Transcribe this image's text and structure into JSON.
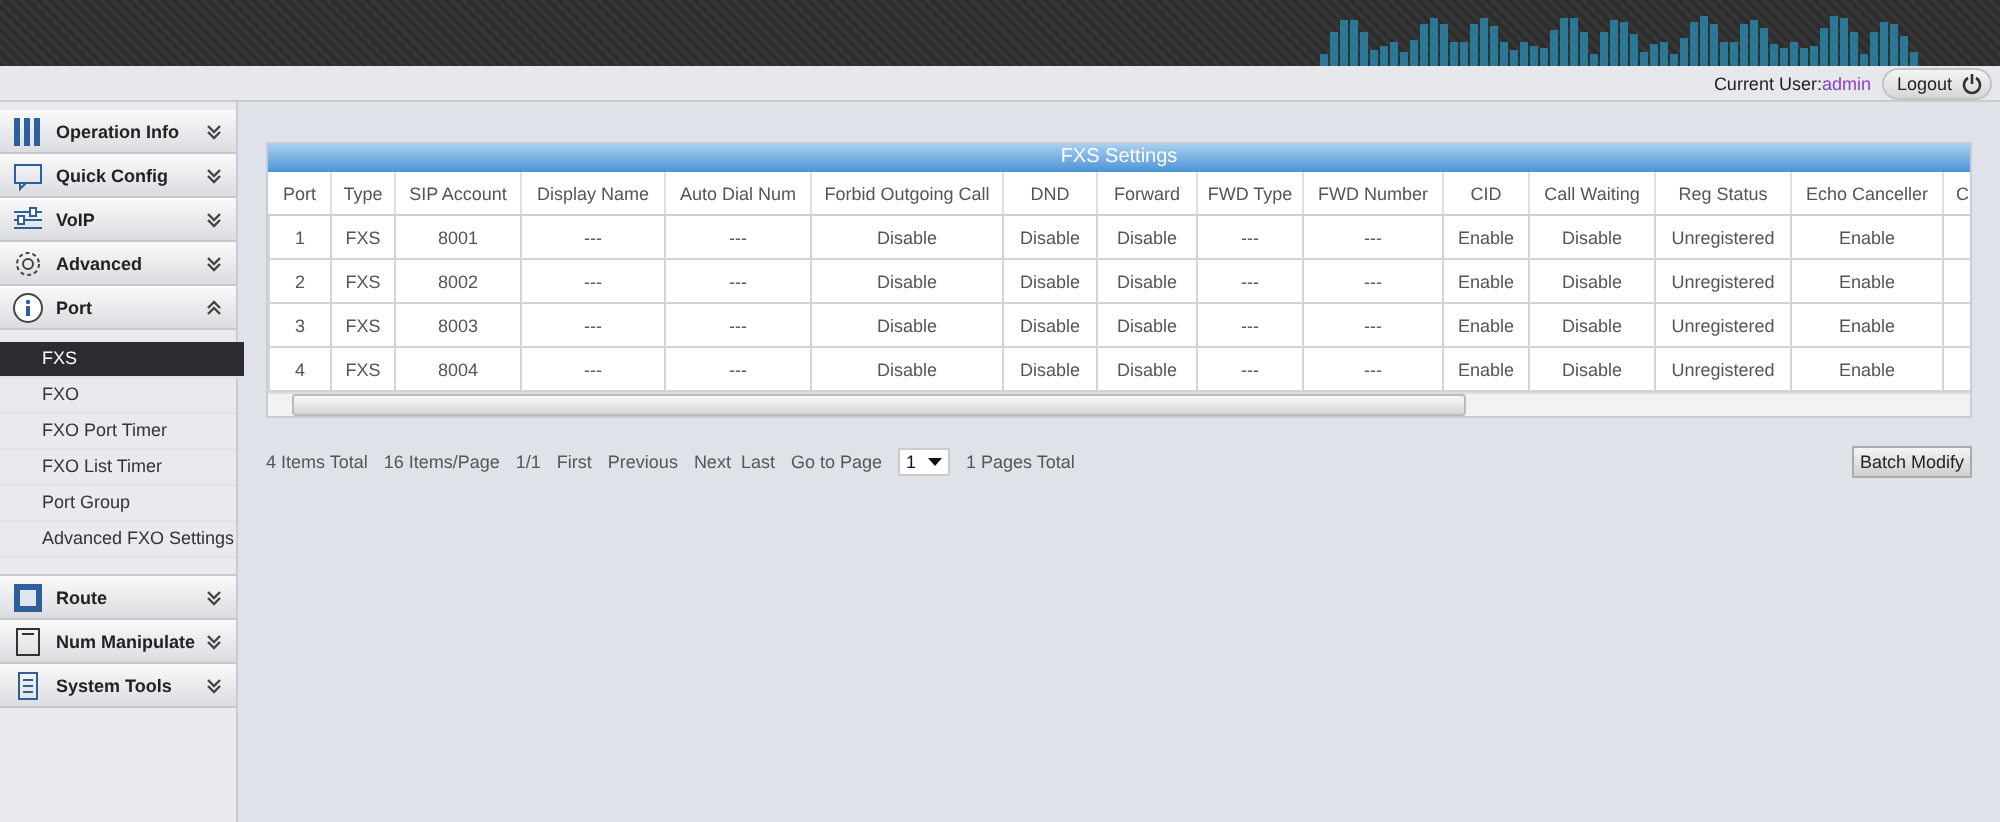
{
  "header": {
    "user_label": "Current User:",
    "user_name": "admin",
    "logout": "Logout"
  },
  "sidebar": {
    "items": [
      {
        "label": "Operation Info",
        "expanded": false
      },
      {
        "label": "Quick Config",
        "expanded": false
      },
      {
        "label": "VoIP",
        "expanded": false
      },
      {
        "label": "Advanced",
        "expanded": false
      },
      {
        "label": "Port",
        "expanded": true,
        "children": [
          {
            "label": "FXS",
            "selected": true
          },
          {
            "label": "FXO",
            "selected": false
          },
          {
            "label": "FXO Port Timer",
            "selected": false
          },
          {
            "label": "FXO List Timer",
            "selected": false
          },
          {
            "label": "Port Group",
            "selected": false
          },
          {
            "label": "Advanced FXO Settings",
            "selected": false
          }
        ]
      },
      {
        "label": "Route",
        "expanded": false
      },
      {
        "label": "Num Manipulate",
        "expanded": false
      },
      {
        "label": "System Tools",
        "expanded": false
      }
    ]
  },
  "table": {
    "title": "FXS Settings",
    "columns": [
      "Port",
      "Type",
      "SIP Account",
      "Display Name",
      "Auto Dial Num",
      "Forbid Outgoing Call",
      "DND",
      "Forward",
      "FWD Type",
      "FWD Number",
      "CID",
      "Call Waiting",
      "Reg Status",
      "Echo Canceller",
      "C"
    ],
    "rows": [
      [
        "1",
        "FXS",
        "8001",
        "---",
        "---",
        "Disable",
        "Disable",
        "Disable",
        "---",
        "---",
        "Enable",
        "Disable",
        "Unregistered",
        "Enable"
      ],
      [
        "2",
        "FXS",
        "8002",
        "---",
        "---",
        "Disable",
        "Disable",
        "Disable",
        "---",
        "---",
        "Enable",
        "Disable",
        "Unregistered",
        "Enable"
      ],
      [
        "3",
        "FXS",
        "8003",
        "---",
        "---",
        "Disable",
        "Disable",
        "Disable",
        "---",
        "---",
        "Enable",
        "Disable",
        "Unregistered",
        "Enable"
      ],
      [
        "4",
        "FXS",
        "8004",
        "---",
        "---",
        "Disable",
        "Disable",
        "Disable",
        "---",
        "---",
        "Enable",
        "Disable",
        "Unregistered",
        "Enable"
      ]
    ]
  },
  "pager": {
    "total": "4 Items Total",
    "per_page": "16 Items/Page",
    "page": "1/1",
    "first": "First",
    "previous": "Previous",
    "next": "Next",
    "last": "Last",
    "goto": "Go to Page",
    "page_select": "1",
    "pages_total": "1 Pages Total"
  },
  "batch_button": "Batch Modify"
}
